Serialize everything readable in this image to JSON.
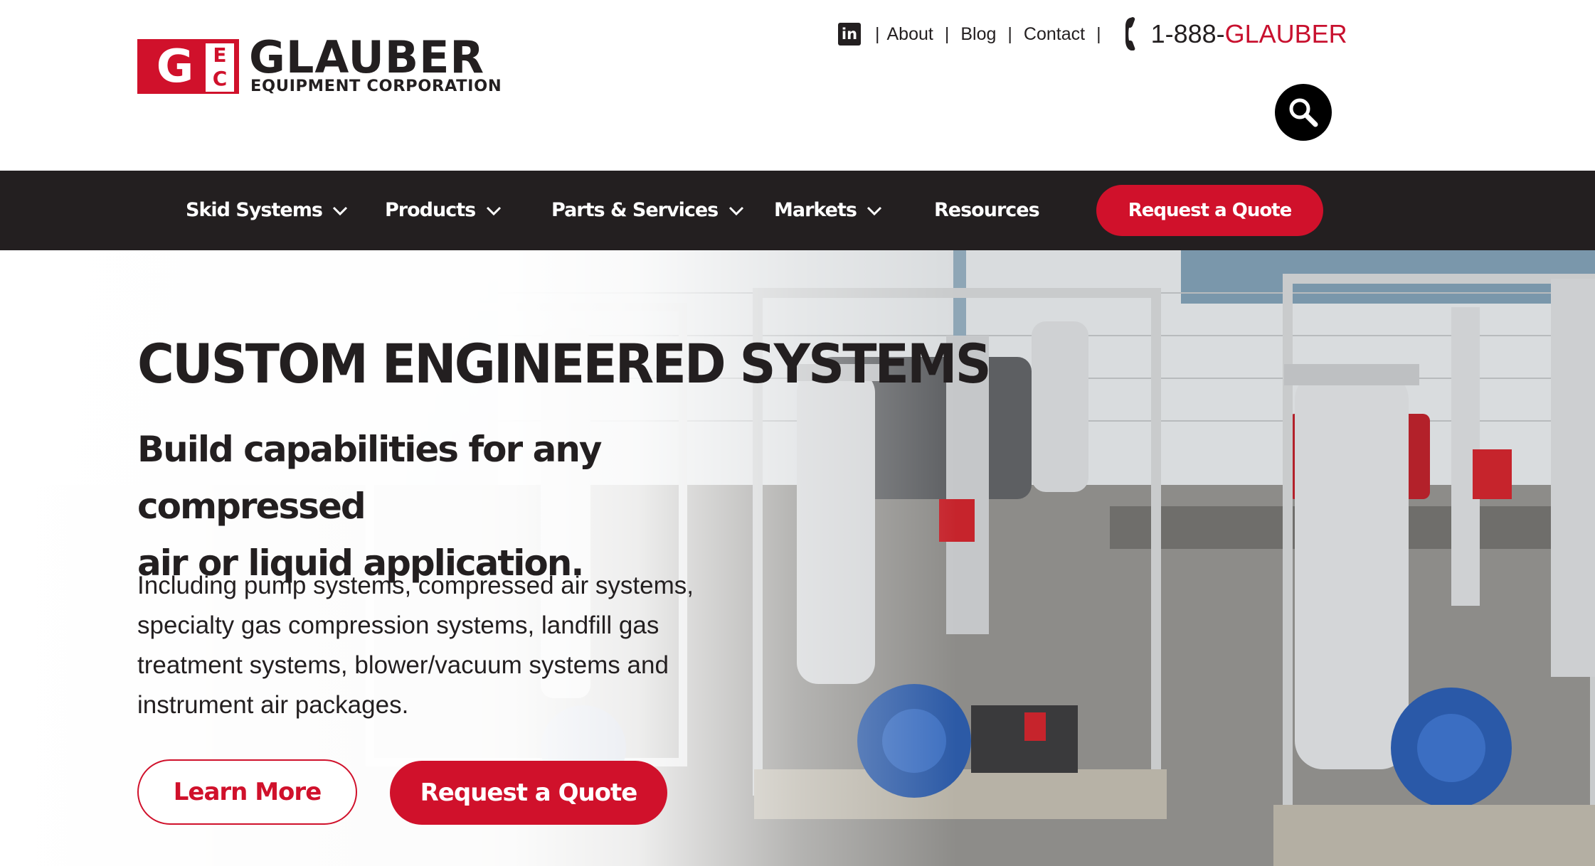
{
  "brand": {
    "logo_mark_g": "G",
    "logo_mark_ec": "E C",
    "name": "GLAUBER",
    "subtitle": "EQUIPMENT CORPORATION",
    "accent_color": "#d0112b",
    "dark_color": "#231f20"
  },
  "utility_nav": {
    "linkedin_icon": "linkedin-icon",
    "linkedin_glyph": "in",
    "separator": "|",
    "links": [
      "About",
      "Blog",
      "Contact"
    ],
    "phone_prefix": "1-888-",
    "phone_word": "GLAUBER",
    "phone_icon": "phone-icon",
    "search_icon": "search-icon"
  },
  "main_nav": {
    "items": [
      {
        "label": "Skid Systems",
        "has_dropdown": true
      },
      {
        "label": "Products",
        "has_dropdown": true
      },
      {
        "label": "Parts & Services",
        "has_dropdown": true
      },
      {
        "label": "Markets",
        "has_dropdown": true
      },
      {
        "label": "Resources",
        "has_dropdown": false
      }
    ],
    "cta_label": "Request a Quote"
  },
  "hero": {
    "title": "CUSTOM ENGINEERED SYSTEMS",
    "subtitle_line1": "Build capabilities for any compressed",
    "subtitle_line2": "air or liquid application.",
    "body_line1": "Including pump systems, compressed air systems,",
    "body_line2": "specialty gas compression systems, landfill gas",
    "body_line3": "treatment systems, blower/vacuum systems and",
    "body_line4": "instrument air packages.",
    "learn_more_label": "Learn More",
    "quote_label": "Request a Quote",
    "background_image": "industrial-skid-systems-photo"
  }
}
